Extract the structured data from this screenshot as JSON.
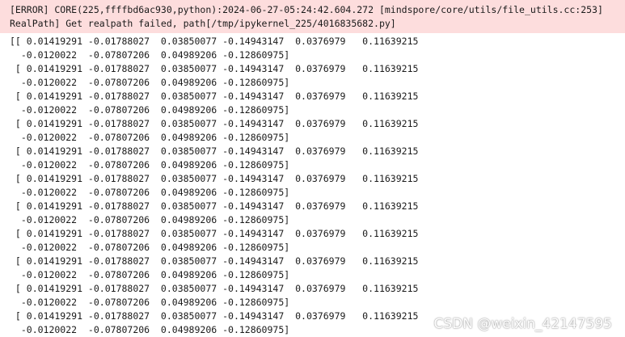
{
  "stderr": {
    "lines": [
      "[ERROR] CORE(225,ffffbd6ac930,python):2024-06-27-05:24:42.604.272 [mindspore/core/utils/file_utils.cc:253]",
      "RealPath] Get realpath failed, path[/tmp/ipykernel_225/4016835682.py]"
    ]
  },
  "output": {
    "rows": [
      {
        "first": "[[ 0.01419291 -0.01788027  0.03850077 -0.14943147  0.0376979   0.11639215",
        "second": "  -0.0120022  -0.07807206  0.04989206 -0.12860975]"
      },
      {
        "first": " [ 0.01419291 -0.01788027  0.03850077 -0.14943147  0.0376979   0.11639215",
        "second": "  -0.0120022  -0.07807206  0.04989206 -0.12860975]"
      },
      {
        "first": " [ 0.01419291 -0.01788027  0.03850077 -0.14943147  0.0376979   0.11639215",
        "second": "  -0.0120022  -0.07807206  0.04989206 -0.12860975]"
      },
      {
        "first": " [ 0.01419291 -0.01788027  0.03850077 -0.14943147  0.0376979   0.11639215",
        "second": "  -0.0120022  -0.07807206  0.04989206 -0.12860975]"
      },
      {
        "first": " [ 0.01419291 -0.01788027  0.03850077 -0.14943147  0.0376979   0.11639215",
        "second": "  -0.0120022  -0.07807206  0.04989206 -0.12860975]"
      },
      {
        "first": " [ 0.01419291 -0.01788027  0.03850077 -0.14943147  0.0376979   0.11639215",
        "second": "  -0.0120022  -0.07807206  0.04989206 -0.12860975]"
      },
      {
        "first": " [ 0.01419291 -0.01788027  0.03850077 -0.14943147  0.0376979   0.11639215",
        "second": "  -0.0120022  -0.07807206  0.04989206 -0.12860975]"
      },
      {
        "first": " [ 0.01419291 -0.01788027  0.03850077 -0.14943147  0.0376979   0.11639215",
        "second": "  -0.0120022  -0.07807206  0.04989206 -0.12860975]"
      },
      {
        "first": " [ 0.01419291 -0.01788027  0.03850077 -0.14943147  0.0376979   0.11639215",
        "second": "  -0.0120022  -0.07807206  0.04989206 -0.12860975]"
      },
      {
        "first": " [ 0.01419291 -0.01788027  0.03850077 -0.14943147  0.0376979   0.11639215",
        "second": "  -0.0120022  -0.07807206  0.04989206 -0.12860975]"
      },
      {
        "first": " [ 0.01419291 -0.01788027  0.03850077 -0.14943147  0.0376979   0.11639215",
        "second": "  -0.0120022  -0.07807206  0.04989206 -0.12860975]"
      }
    ]
  },
  "watermark": {
    "text": "CSDN @weixin_42147595"
  },
  "colors": {
    "stderr_background": "#fddddd",
    "text": "#1a1a1a",
    "background": "#ffffff"
  }
}
